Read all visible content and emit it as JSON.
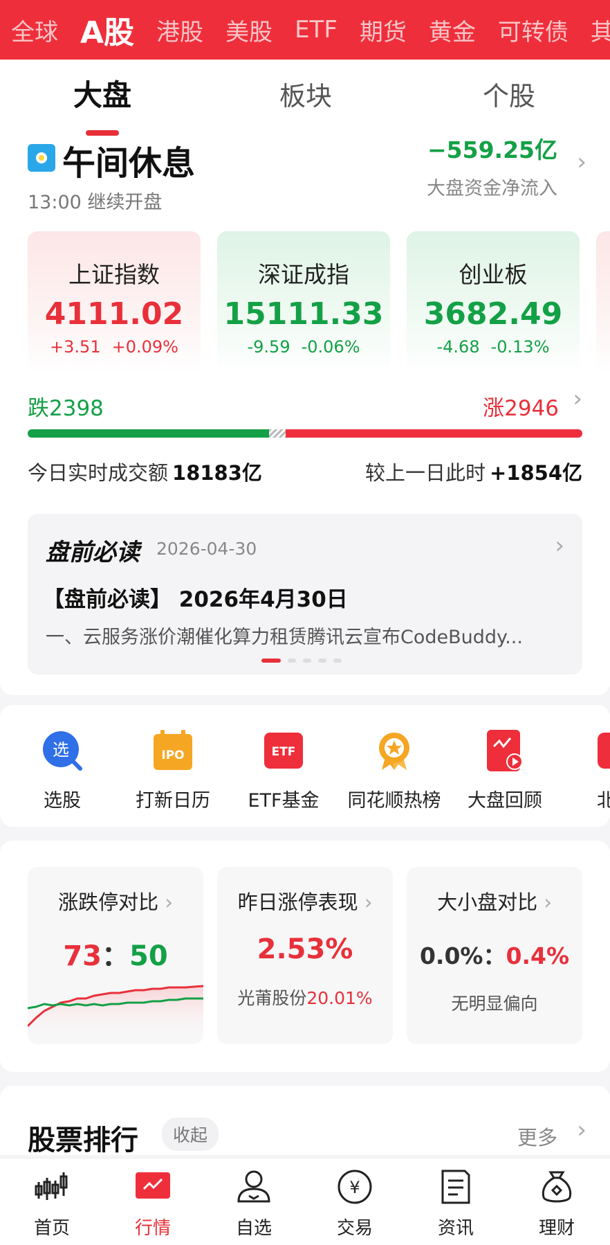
{
  "market_tabs": [
    "全球",
    "A股",
    "港股",
    "美股",
    "ETF",
    "期货",
    "黄金",
    "可转债",
    "其他"
  ],
  "market_active": "A股",
  "sub_tabs": [
    "大盘",
    "板块",
    "个股"
  ],
  "status": {
    "title": "午间休息",
    "subtitle": "13:00 继续开盘",
    "net_flow_value": "−559.25亿",
    "net_flow_label": "大盘资金净流入"
  },
  "indices": [
    {
      "name": "上证指数",
      "value": "4111.02",
      "change": "+3.51",
      "pct": "+0.09%",
      "trend": "up"
    },
    {
      "name": "深证成指",
      "value": "15111.33",
      "change": "-9.59",
      "pct": "-0.06%",
      "trend": "down"
    },
    {
      "name": "创业板",
      "value": "3682.49",
      "change": "-4.68",
      "pct": "-0.13%",
      "trend": "down"
    }
  ],
  "breadth": {
    "fall_label": "跌2398",
    "rise_label": "涨2946",
    "fall": 2398,
    "rise": 2946
  },
  "turnover": {
    "label": "今日实时成交额",
    "value": "18183亿",
    "compare_label": "较上一日此时",
    "compare_value": "+1854亿"
  },
  "news": {
    "brand": "盘前必读",
    "date": "2026-04-30",
    "title": "【盘前必读】 2026年4月30日",
    "summary": "一、云服务涨价潮催化算力租赁腾讯云宣布CodeBuddy..."
  },
  "shortcuts": [
    {
      "label": "选股",
      "icon": "stock-picker-icon"
    },
    {
      "label": "打新日历",
      "icon": "ipo-calendar-icon"
    },
    {
      "label": "ETF基金",
      "icon": "etf-fund-icon"
    },
    {
      "label": "同花顺热榜",
      "icon": "hot-list-icon"
    },
    {
      "label": "大盘回顾",
      "icon": "market-review-icon"
    },
    {
      "label": "北交",
      "icon": "beijiao-icon"
    }
  ],
  "stats": {
    "limit": {
      "title": "涨跌停对比",
      "up": "73",
      "sep": "：",
      "down": "50"
    },
    "yesterday": {
      "title": "昨日涨停表现",
      "value": "2.53%",
      "sub_name": "光莆股份",
      "sub_value": "20.01%"
    },
    "size": {
      "title": "大小盘对比",
      "left": "0.0%",
      "sep": "：",
      "right": "0.4%",
      "sub": "无明显偏向"
    }
  },
  "ranking": {
    "title": "股票排行",
    "collapse": "收起",
    "more": "更多"
  },
  "nav": [
    {
      "label": "首页",
      "icon": "home-icon"
    },
    {
      "label": "行情",
      "icon": "market-icon"
    },
    {
      "label": "自选",
      "icon": "watchlist-icon"
    },
    {
      "label": "交易",
      "icon": "trade-icon"
    },
    {
      "label": "资讯",
      "icon": "news-icon"
    },
    {
      "label": "理财",
      "icon": "wealth-icon"
    }
  ],
  "colors": {
    "brand_red": "#ee2f3b",
    "up": "#e8303a",
    "down": "#14a046"
  }
}
